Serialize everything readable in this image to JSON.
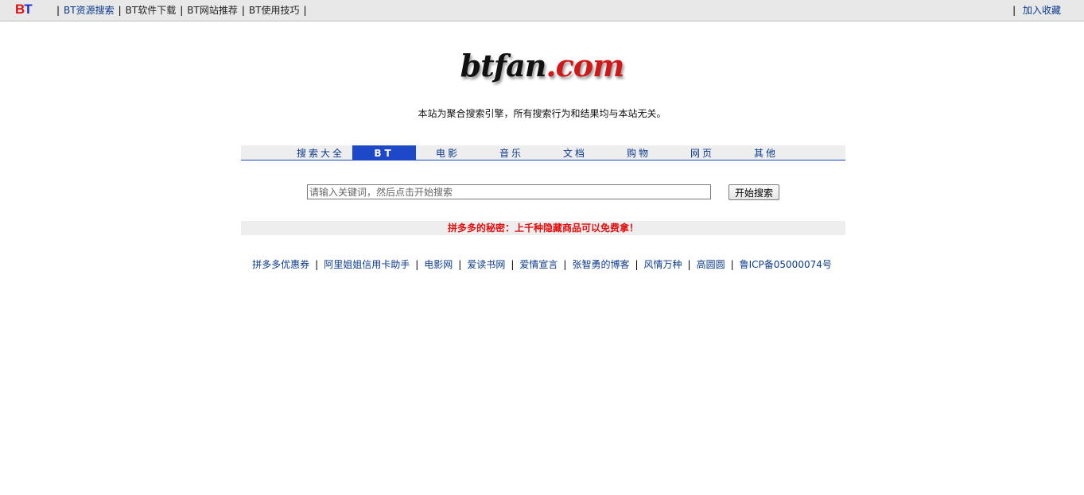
{
  "topbar": {
    "logo": {
      "b": "B",
      "t": "T"
    },
    "nav": [
      {
        "label": "BT资源搜索",
        "style": "blue"
      },
      {
        "label": "BT软件下载",
        "style": "dark"
      },
      {
        "label": "BT网站推荐",
        "style": "dark"
      },
      {
        "label": "BT使用技巧",
        "style": "dark"
      }
    ],
    "separator": "|",
    "favorite": "加入收藏"
  },
  "logo": {
    "name": "btfan",
    "domain": ".com"
  },
  "notice": "本站为聚合搜索引擎，所有搜索行为和结果均与本站无关。",
  "tabs": [
    {
      "label": "搜索大全",
      "active": false
    },
    {
      "label": "BT",
      "active": true
    },
    {
      "label": "电影",
      "active": false
    },
    {
      "label": "音乐",
      "active": false
    },
    {
      "label": "文档",
      "active": false
    },
    {
      "label": "购物",
      "active": false
    },
    {
      "label": "网页",
      "active": false
    },
    {
      "label": "其他",
      "active": false
    }
  ],
  "search": {
    "placeholder": "请输入关键词，然后点击开始搜索",
    "value": "",
    "button": "开始搜索"
  },
  "promo": "拼多多的秘密：上千种隐藏商品可以免费拿！",
  "footer": {
    "links": [
      "拼多多优惠券",
      "阿里姐姐信用卡助手",
      "电影网",
      "爱读书网",
      "爱情宣言",
      "张智勇的博客",
      "风情万种",
      "高圆圆",
      "鲁ICP备05000074号"
    ],
    "separator": "|"
  },
  "colors": {
    "link_blue": "#0b3a8c",
    "tab_active": "#1d49c8",
    "promo_red": "#e01010",
    "bar_gray": "#eeeeee"
  }
}
